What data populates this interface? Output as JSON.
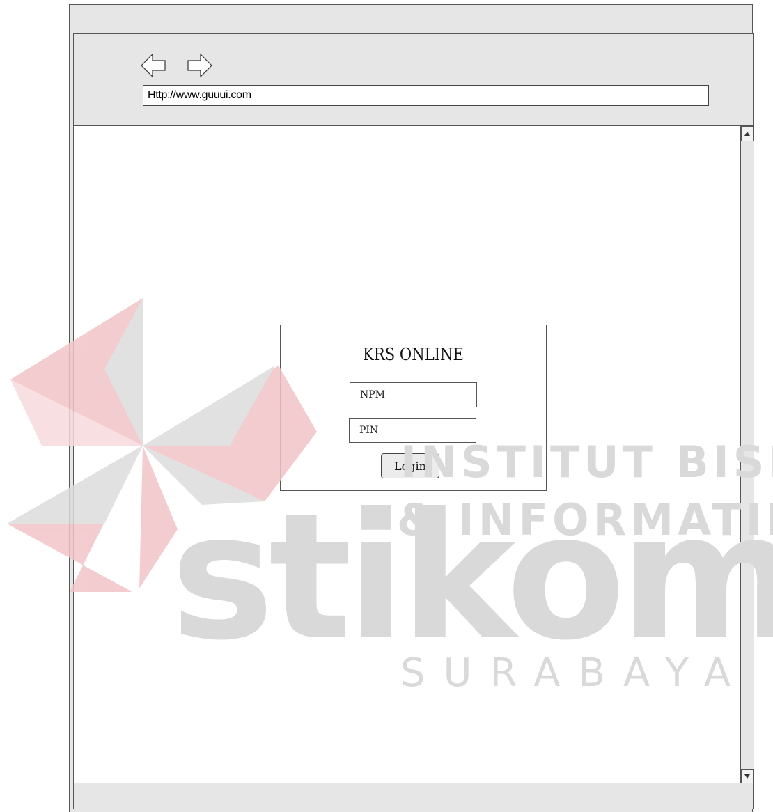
{
  "browser": {
    "url": "Http://www.guuui.com",
    "nav": {
      "back_icon": "left-arrow-icon",
      "forward_icon": "right-arrow-icon"
    },
    "scrollbar": {
      "up_icon": "triangle-up-icon",
      "down_icon": "triangle-down-icon"
    }
  },
  "login": {
    "title": "KRS ONLINE",
    "npm_placeholder": "NPM",
    "pin_placeholder": "PIN",
    "button_label": "Login"
  },
  "watermark": {
    "line1": "INSTITUT BISNIS",
    "line2": "& INFORMATIKA",
    "brand": "stikom",
    "city": "SURABAYA",
    "colors": {
      "red": "#f2c4c8",
      "gray": "#dcdcdc"
    }
  }
}
